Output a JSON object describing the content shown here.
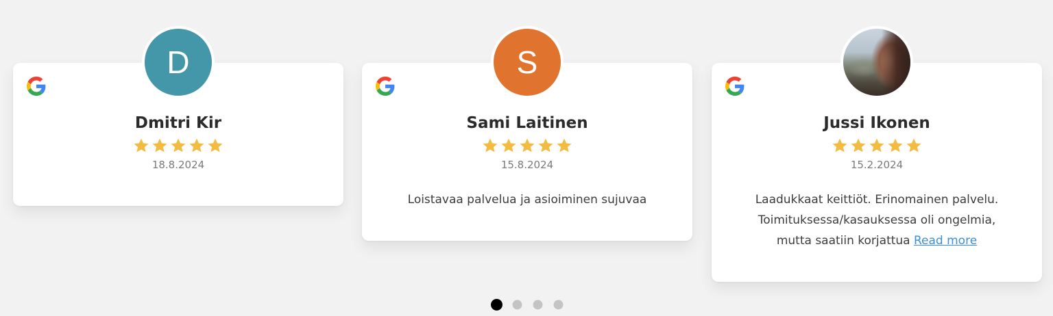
{
  "colors": {
    "background": "#f2f2f2",
    "star": "#f2bc43",
    "link": "#3a8fd6",
    "dot_active": "#000000",
    "dot_inactive": "#c4c4c4"
  },
  "reviews": [
    {
      "avatar_letter": "D",
      "avatar_color": "#4397a9",
      "name": "Dmitri Kir",
      "rating": 5,
      "date": "18.8.2024",
      "text": "",
      "source_icon": "google-icon"
    },
    {
      "avatar_letter": "S",
      "avatar_color": "#e0732e",
      "name": "Sami Laitinen",
      "rating": 5,
      "date": "15.8.2024",
      "text": "Loistavaa palvelua ja asioiminen sujuvaa",
      "source_icon": "google-icon"
    },
    {
      "avatar_letter": "",
      "avatar_color": "",
      "name": "Jussi Ikonen",
      "rating": 5,
      "date": "15.2.2024",
      "text_lines": [
        "Laadukkaat keittiöt. Erinomainen palvelu.",
        "Toimituksessa/kasauksessa oli ongelmia,",
        "mutta saatiin korjattua"
      ],
      "read_more": "Read more",
      "source_icon": "google-icon"
    }
  ],
  "pagination": {
    "total": 4,
    "active_index": 0
  }
}
